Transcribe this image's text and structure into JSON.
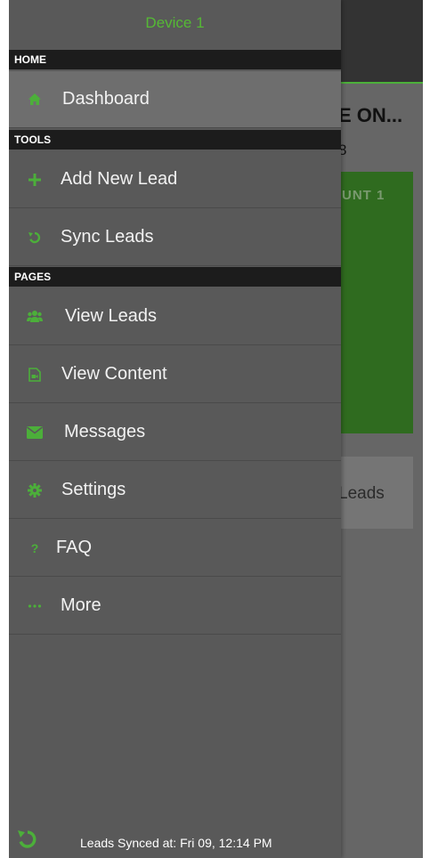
{
  "app": {
    "title": "E ON...",
    "subtitle": "8",
    "card_label": "UNT 1",
    "leads_button": "Leads"
  },
  "drawer": {
    "device_name": "Device 1",
    "sections": [
      {
        "label": "HOME"
      },
      {
        "label": "TOOLS"
      },
      {
        "label": "PAGES"
      }
    ],
    "items": [
      {
        "label": "Dashboard",
        "icon": "home-icon"
      },
      {
        "label": "Add New Lead",
        "icon": "plus-icon"
      },
      {
        "label": "Sync Leads",
        "icon": "sync-icon"
      },
      {
        "label": "View Leads",
        "icon": "users-icon"
      },
      {
        "label": "View Content",
        "icon": "video-file-icon"
      },
      {
        "label": "Messages",
        "icon": "envelope-icon"
      },
      {
        "label": "Settings",
        "icon": "gear-icon"
      },
      {
        "label": "FAQ",
        "icon": "question-icon"
      },
      {
        "label": "More",
        "icon": "ellipsis-icon"
      }
    ],
    "footer_text": "Leads Synced at: Fri 09, 12:14 PM"
  },
  "colors": {
    "accent": "#4caf3a",
    "drawer_bg": "#595959",
    "section_bg": "#1c1c1c"
  }
}
